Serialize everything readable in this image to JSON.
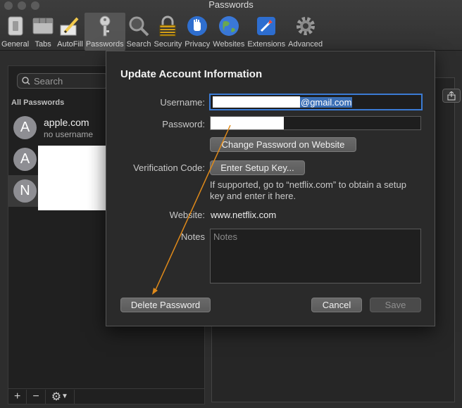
{
  "window": {
    "title": "Passwords"
  },
  "toolbar": [
    {
      "label": "General",
      "icon": "switch-icon"
    },
    {
      "label": "Tabs",
      "icon": "tabs-icon"
    },
    {
      "label": "AutoFill",
      "icon": "pencil-icon"
    },
    {
      "label": "Passwords",
      "icon": "key-icon",
      "active": true
    },
    {
      "label": "Search",
      "icon": "magnifier-icon"
    },
    {
      "label": "Security",
      "icon": "lock-icon"
    },
    {
      "label": "Privacy",
      "icon": "hand-icon"
    },
    {
      "label": "Websites",
      "icon": "globe-icon"
    },
    {
      "label": "Extensions",
      "icon": "extensions-icon"
    },
    {
      "label": "Advanced",
      "icon": "gear-icon"
    }
  ],
  "sidebar": {
    "search_placeholder": "Search",
    "section_label": "All Passwords",
    "items": [
      {
        "initial": "A",
        "title": "apple.com",
        "subtitle": "no username"
      },
      {
        "initial": "A",
        "title": "",
        "subtitle": ""
      },
      {
        "initial": "N",
        "title": "",
        "subtitle": ""
      }
    ]
  },
  "dialog": {
    "title": "Update Account Information",
    "username_label": "Username:",
    "username_value_visible": "gmail.com",
    "username_prefix": "@",
    "password_label": "Password:",
    "change_password_button": "Change Password on Website",
    "verification_label": "Verification Code:",
    "setup_key_button": "Enter Setup Key...",
    "hint": "If supported, go to “netflix.com” to obtain a setup key and enter it here.",
    "website_label": "Website:",
    "website_value": "www.netflix.com",
    "notes_label": "Notes",
    "notes_placeholder": "Notes",
    "delete_button": "Delete Password",
    "cancel_button": "Cancel",
    "save_button": "Save"
  },
  "colors": {
    "accent": "#3b7bd4",
    "annotation_arrow": "#e08a1a"
  }
}
